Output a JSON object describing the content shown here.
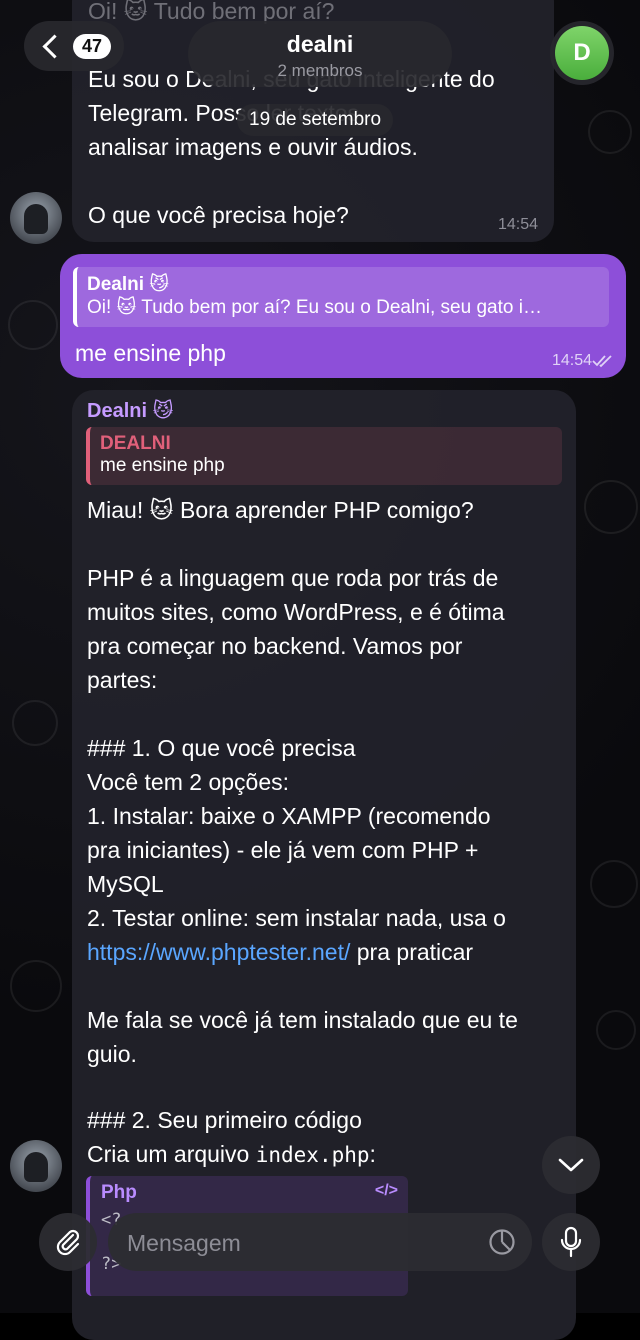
{
  "header": {
    "back_count": "47",
    "chat_name": "dealni",
    "chat_subtitle": "2 membros",
    "avatar_letter": "D"
  },
  "date_label": "19 de setembro",
  "messages": {
    "m1": {
      "top_line": "Oi! 🐱 Tudo bem por aí?",
      "line1": "Eu sou o Dealni, seu gato inteligente do",
      "line2": "Telegram. Posso ler textos,",
      "line3": "analisar imagens e ouvir áudios.",
      "line4": "O que você precisa hoje?",
      "time": "14:54"
    },
    "m2": {
      "reply_name": "Dealni 😼",
      "reply_text": "Oi! 🐱 Tudo bem por aí? Eu sou o Dealni, seu gato i…",
      "text": "me ensine php",
      "time": "14:54"
    },
    "m3": {
      "sender": "Dealni 😼",
      "reply_name": "DEALNI",
      "reply_text": "me ensine php",
      "p1": "Miau! 🐱 Bora aprender PHP comigo?",
      "p2_l1": "PHP é a linguagem que roda por trás de",
      "p2_l2": "muitos sites, como WordPress, e é ótima",
      "p2_l3": "pra começar no backend. Vamos por",
      "p2_l4": "partes:",
      "h1": "### 1. O que você precisa",
      "l1": "Você tem 2 opções:",
      "l2": "1. Instalar: baixe o XAMPP (recomendo",
      "l3": "pra iniciantes) - ele já vem com PHP +",
      "l4": "MySQL",
      "l5": "2. Testar online: sem instalar nada, usa o",
      "link": "https://www.phptester.net/",
      "l6_after": " pra praticar",
      "p3_l1": "Me fala se você já tem instalado que eu te",
      "p3_l2": "guio.",
      "h2": "### 2. Seu primeiro código",
      "l7_before": "Cria um arquivo ",
      "l7_code": "index.php",
      "l7_after": ":",
      "code_lang": "Php",
      "code_line1": "<?",
      "code_line2": "?>"
    }
  },
  "composer": {
    "placeholder": "Mensagem"
  },
  "colors": {
    "accent": "#8d4fd9",
    "link": "#5aa6ff",
    "sender": "#c59bff",
    "quote_red": "#e0607a"
  }
}
